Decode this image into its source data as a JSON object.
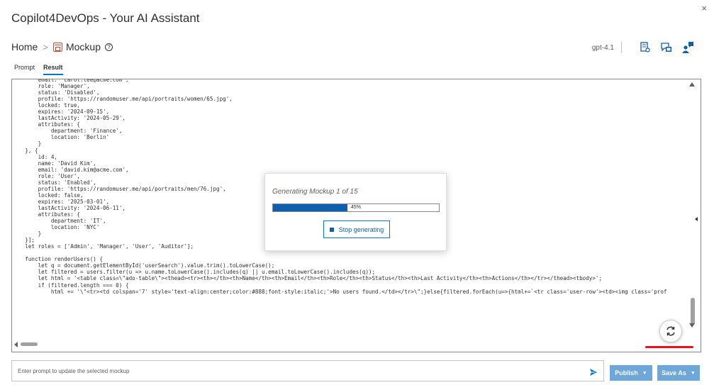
{
  "app": {
    "title": "Copilot4DevOps - Your AI Assistant",
    "close_label": "×"
  },
  "breadcrumb": {
    "home": "Home",
    "separator": ">",
    "current": "Mockup",
    "help_icon": "question-circle-icon",
    "help_glyph": "?"
  },
  "toolbar": {
    "model": "gpt-4.1",
    "icons": [
      "document-settings-icon",
      "chat-image-icon",
      "user-feedback-icon"
    ]
  },
  "tabs": [
    {
      "label": "Prompt",
      "active": false
    },
    {
      "label": "Result",
      "active": true
    }
  ],
  "code_lines": [
    "        email: 'carol.lee@acme.com',",
    "        role: 'Manager',",
    "        status: 'Disabled',",
    "        profile: 'https://randomuser.me/api/portraits/women/65.jpg',",
    "        locked: true,",
    "        expires: '2024-09-15',",
    "        lastActivity: '2024-05-29',",
    "        attributes: {",
    "            department: 'Finance',",
    "            location: 'Berlin'",
    "        }",
    "    }, {",
    "        id: 4,",
    "        name: 'David Kim',",
    "        email: 'david.kim@acme.com',",
    "        role: 'User',",
    "        status: 'Enabled',",
    "        profile: 'https://randomuser.me/api/portraits/men/76.jpg',",
    "        locked: false,",
    "        expires: '2025-03-01',",
    "        lastActivity: '2024-06-11',",
    "        attributes: {",
    "            department: 'IT',",
    "            location: 'NYC'",
    "        }",
    "    }];",
    "    let roles = ['Admin', 'Manager', 'User', 'Auditor'];",
    "",
    "    function renderUsers() {",
    "        let q = document.getElementById('userSearch').value.trim().toLowerCase();",
    "        let filtered = users.filter(u => u.name.toLowerCase().includes(q) || u.email.toLowerCase().includes(q));",
    "        let html = '<table class=\\\"ado-table\\\"><thead><tr><th></th><th>Name</th><th>Email</th><th>Role</th><th>Status</th><th>Last Activity</th><th>Actions</th></tr></thead><tbody>';",
    "        if (filtered.length === 0) {",
    "            html += '\\\"<tr><td colspan='7' style='text-align:center;color:#888;font-style:italic;'>No users found.</td></tr>\\\";}else{filtered.forEach(u=>{html+=`<tr class='user-row'><td><img class='prof"
  ],
  "progress": {
    "title": "Generating Mockup 1 of 15",
    "percent": 45,
    "percent_label": "45%",
    "stop_label": "Stop generating"
  },
  "prompt": {
    "placeholder": "Enter prompt to update the selected mockup",
    "value": ""
  },
  "actions": {
    "publish": "Publish",
    "save_as": "Save As"
  },
  "colors": {
    "accent": "#0078d4",
    "progress_fill": "#0f5fb0",
    "action_button": "#6ea8db",
    "highlight": "#e81123"
  }
}
